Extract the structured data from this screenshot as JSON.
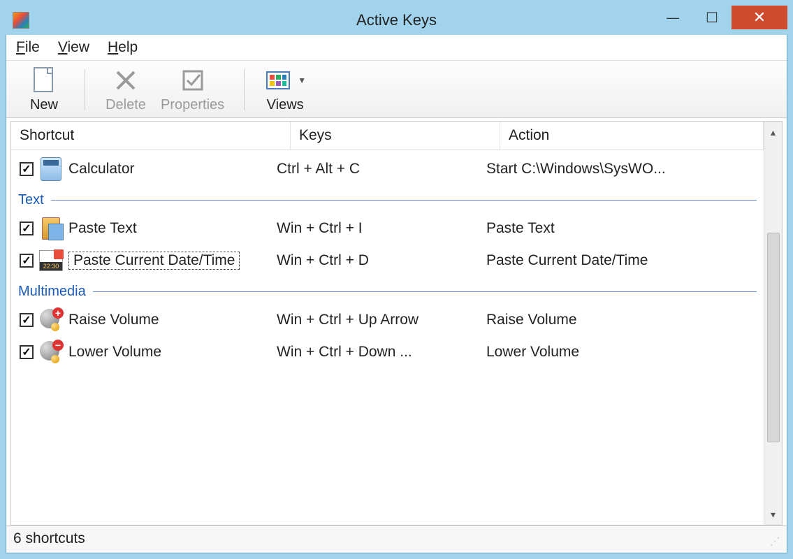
{
  "window": {
    "title": "Active Keys"
  },
  "titlebar_buttons": {
    "minimize": "—",
    "maximize": "☐",
    "close": "✕"
  },
  "menubar": [
    {
      "label": "File",
      "accel": "F"
    },
    {
      "label": "View",
      "accel": "V"
    },
    {
      "label": "Help",
      "accel": "H"
    }
  ],
  "toolbar": {
    "new": "New",
    "delete": "Delete",
    "properties": "Properties",
    "views": "Views"
  },
  "columns": {
    "shortcut": "Shortcut",
    "keys": "Keys",
    "action": "Action"
  },
  "groups": [
    {
      "name": null,
      "items": [
        {
          "checked": true,
          "icon": "calculator",
          "name": "Calculator",
          "keys": "Ctrl + Alt + C",
          "action": "Start C:\\Windows\\SysWO...",
          "focused": false
        }
      ]
    },
    {
      "name": "Text",
      "items": [
        {
          "checked": true,
          "icon": "paste-text",
          "name": "Paste Text",
          "keys": "Win + Ctrl + I",
          "action": "Paste Text",
          "focused": false
        },
        {
          "checked": true,
          "icon": "paste-date",
          "name": "Paste Current Date/Time",
          "keys": "Win + Ctrl + D",
          "action": "Paste Current Date/Time",
          "focused": true
        }
      ]
    },
    {
      "name": "Multimedia",
      "items": [
        {
          "checked": true,
          "icon": "volume-up",
          "name": "Raise Volume",
          "keys": "Win + Ctrl + Up Arrow",
          "action": "Raise Volume",
          "focused": false
        },
        {
          "checked": true,
          "icon": "volume-down",
          "name": "Lower Volume",
          "keys": "Win + Ctrl + Down ...",
          "action": "Lower Volume",
          "focused": false
        }
      ]
    }
  ],
  "statusbar": {
    "text": "6 shortcuts"
  }
}
